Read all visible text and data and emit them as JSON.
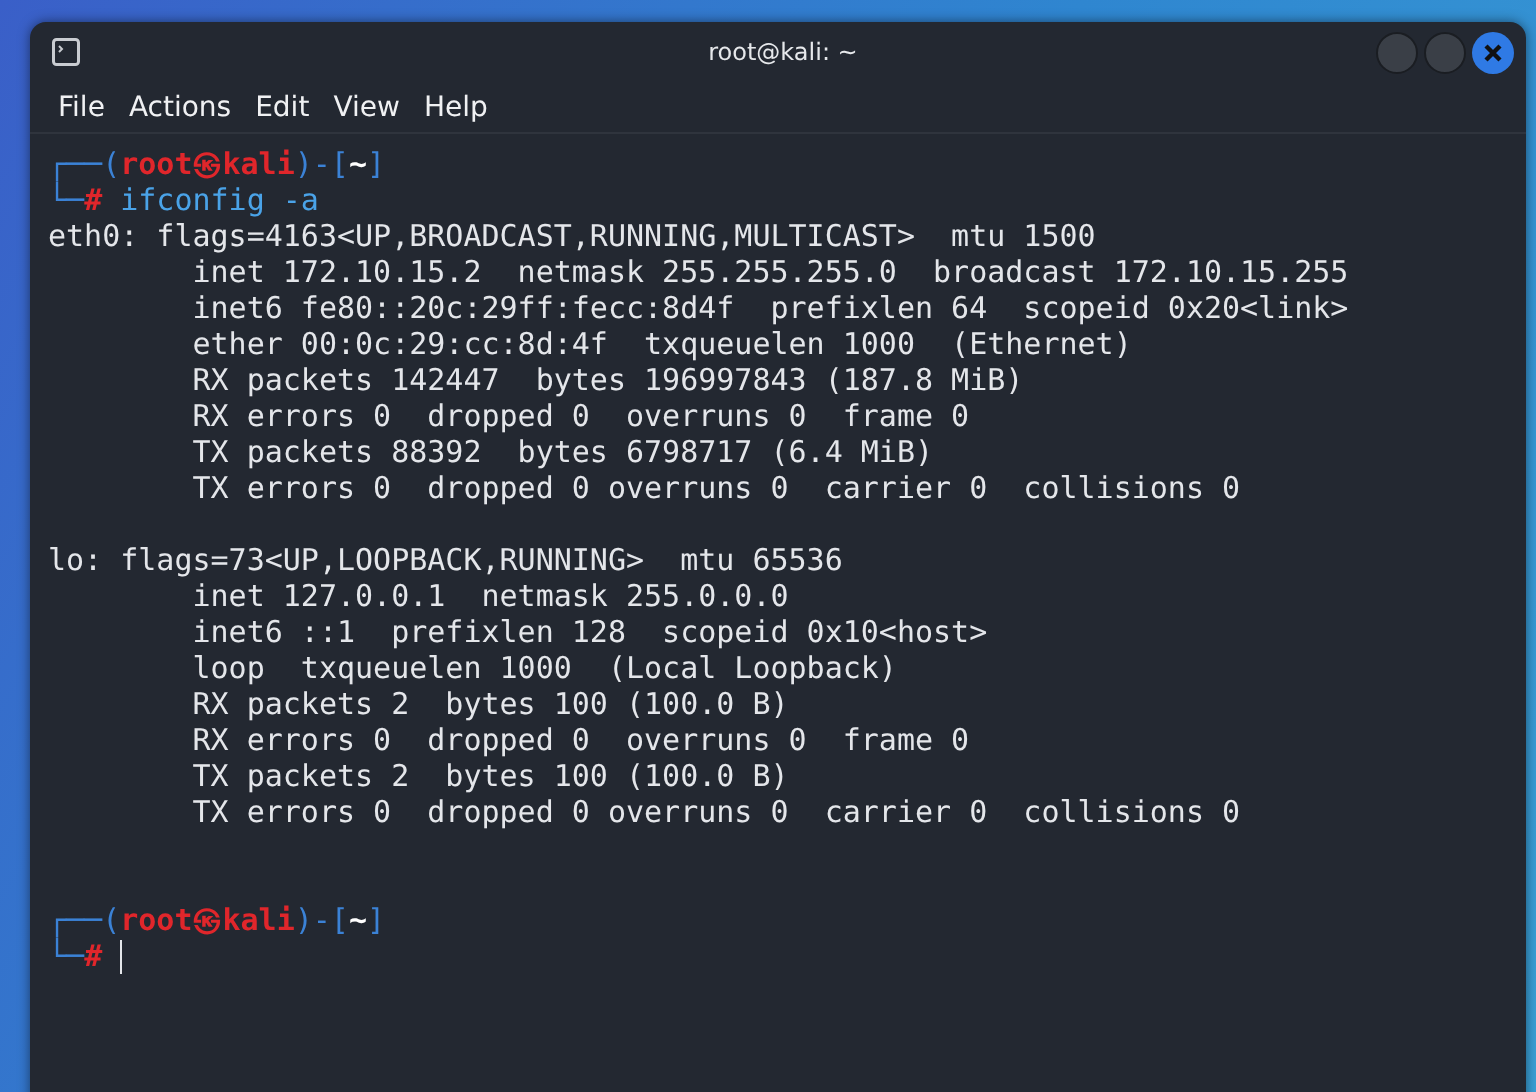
{
  "window": {
    "title": "root@kali: ~"
  },
  "menu": [
    "File",
    "Actions",
    "Edit",
    "View",
    "Help"
  ],
  "terminal": {
    "lines": [
      {
        "kind": "prompt",
        "segments": [
          {
            "text": "┌──(",
            "kind": "frame"
          },
          {
            "text": "root㉿kali",
            "kind": "user"
          },
          {
            "text": ")-[",
            "kind": "frame"
          },
          {
            "text": "~",
            "kind": "dir"
          },
          {
            "text": "]",
            "kind": "frame"
          }
        ]
      },
      {
        "kind": "prompt",
        "segments": [
          {
            "text": "└─",
            "kind": "frame"
          },
          {
            "text": "#",
            "kind": "hash"
          },
          {
            "text": " ifconfig -a",
            "kind": "command"
          }
        ]
      },
      {
        "kind": "output",
        "text": "eth0: flags=4163<UP,BROADCAST,RUNNING,MULTICAST>  mtu 1500"
      },
      {
        "kind": "output",
        "text": "        inet 172.10.15.2  netmask 255.255.255.0  broadcast 172.10.15.255"
      },
      {
        "kind": "output",
        "text": "        inet6 fe80::20c:29ff:fecc:8d4f  prefixlen 64  scopeid 0x20<link>"
      },
      {
        "kind": "output",
        "text": "        ether 00:0c:29:cc:8d:4f  txqueuelen 1000  (Ethernet)"
      },
      {
        "kind": "output",
        "text": "        RX packets 142447  bytes 196997843 (187.8 MiB)"
      },
      {
        "kind": "output",
        "text": "        RX errors 0  dropped 0  overruns 0  frame 0"
      },
      {
        "kind": "output",
        "text": "        TX packets 88392  bytes 6798717 (6.4 MiB)"
      },
      {
        "kind": "output",
        "text": "        TX errors 0  dropped 0 overruns 0  carrier 0  collisions 0"
      },
      {
        "kind": "blank"
      },
      {
        "kind": "output",
        "text": "lo: flags=73<UP,LOOPBACK,RUNNING>  mtu 65536"
      },
      {
        "kind": "output",
        "text": "        inet 127.0.0.1  netmask 255.0.0.0"
      },
      {
        "kind": "output",
        "text": "        inet6 ::1  prefixlen 128  scopeid 0x10<host>"
      },
      {
        "kind": "output",
        "text": "        loop  txqueuelen 1000  (Local Loopback)"
      },
      {
        "kind": "output",
        "text": "        RX packets 2  bytes 100 (100.0 B)"
      },
      {
        "kind": "output",
        "text": "        RX errors 0  dropped 0  overruns 0  frame 0"
      },
      {
        "kind": "output",
        "text": "        TX packets 2  bytes 100 (100.0 B)"
      },
      {
        "kind": "output",
        "text": "        TX errors 0  dropped 0 overruns 0  carrier 0  collisions 0"
      },
      {
        "kind": "blank"
      },
      {
        "kind": "blank"
      },
      {
        "kind": "prompt",
        "segments": [
          {
            "text": "┌──(",
            "kind": "frame"
          },
          {
            "text": "root㉿kali",
            "kind": "user"
          },
          {
            "text": ")-[",
            "kind": "frame"
          },
          {
            "text": "~",
            "kind": "dir"
          },
          {
            "text": "]",
            "kind": "frame"
          }
        ]
      },
      {
        "kind": "prompt",
        "segments": [
          {
            "text": "└─",
            "kind": "frame"
          },
          {
            "text": "#",
            "kind": "hash"
          }
        ],
        "cursor": true
      }
    ]
  }
}
